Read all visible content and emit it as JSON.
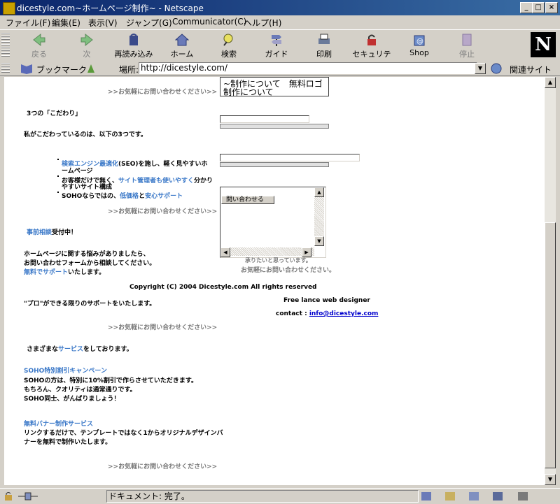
{
  "window": {
    "title": "dicestyle.com~ホームページ制作~ - Netscape",
    "controls": [
      "_",
      "□",
      "×"
    ]
  },
  "menu": [
    "ファイル(F)",
    "編集(E)",
    "表示(V)",
    "ジャンプ(G)",
    "Communicator(C)",
    "ヘルプ(H)"
  ],
  "toolbar": {
    "buttons": [
      {
        "label": "戻る",
        "icon": "back-arrow-icon",
        "enabled": false
      },
      {
        "label": "次",
        "icon": "forward-arrow-icon",
        "enabled": false
      },
      {
        "label": "再読み込み",
        "icon": "reload-icon",
        "enabled": true
      },
      {
        "label": "ホーム",
        "icon": "home-icon",
        "enabled": true
      },
      {
        "label": "検索",
        "icon": "search-icon",
        "enabled": true
      },
      {
        "label": "ガイド",
        "icon": "guide-icon",
        "enabled": true
      },
      {
        "label": "印刷",
        "icon": "print-icon",
        "enabled": true
      },
      {
        "label": "セキュリティ",
        "icon": "security-lock-icon",
        "enabled": true
      },
      {
        "label": "Shop",
        "icon": "shop-icon",
        "enabled": true
      },
      {
        "label": "停止",
        "icon": "stop-icon",
        "enabled": false
      }
    ],
    "logo": "N"
  },
  "location": {
    "bookmarks_label": "ブックマーク",
    "label": "場所:",
    "url": "http://dicestyle.com/",
    "related_label": "関連サイト"
  },
  "page": {
    "contact_link": ">>お気軽にお問い合わせください>>",
    "overlay_line1": "~制作について　無料ロゴ",
    "overlay_line2": "制作について",
    "heading_3": "3つの「こだわり」",
    "intro": "私がこだわっているのは、以下の3つです。",
    "point1_a": "検索エンジン最適化",
    "point1_b": "(SEO)を施し、軽く見やすいホ",
    "point1_c": "ームページ",
    "point2_a": "お客様だけで無く、",
    "point2_b": "サイト管理者も使いやすく",
    "point2_c": "分かり",
    "point2_d": "やすいサイト構成",
    "point3_a": "SOHOならではの、",
    "point3_b": "低価格",
    "point3_c": "と",
    "point3_d": "安心サポート",
    "free_consult_a": "事前相談",
    "free_consult_b": "受付中！",
    "consult_1": "ホームページに関する悩みがありましたら、",
    "consult_2": "お問い合わせフォームから相談してください。",
    "consult_3a": "無料でサポート",
    "consult_3b": "いたします。",
    "behind_form_1": "承りたいと思っています。",
    "behind_form_2": "お気軽にお問い合わせください。",
    "copyright": "Copyright (C) 2004 Dicestyle.com All rights reserved",
    "pro_support": "\"プロ\"ができる限りのサポートをいたします。",
    "freelance": "Free lance web designer",
    "contact_label": "contact : ",
    "contact_email": "info@dicestyle.com",
    "services_a": "さまざまな",
    "services_b": "サービス",
    "services_c": "をしております。",
    "soho_title": "SOHO特別割引キャンペーン",
    "soho_1": "SOHOの方は、特別に10%割引で作らさせていただきます。",
    "soho_2": "もちろん、クオリティは通常通りです。",
    "soho_3": "SOHO同士、がんばりましょう！",
    "banner_title": "無料バナー制作サービス",
    "banner_1": "リンクするだけで、テンプレートではなく1からオリジナルデザインバ",
    "banner_2": "ナーを無料で制作いたします。",
    "submit_button": "問い合わせる"
  },
  "status": {
    "text": "ドキュメント: 完了。"
  }
}
